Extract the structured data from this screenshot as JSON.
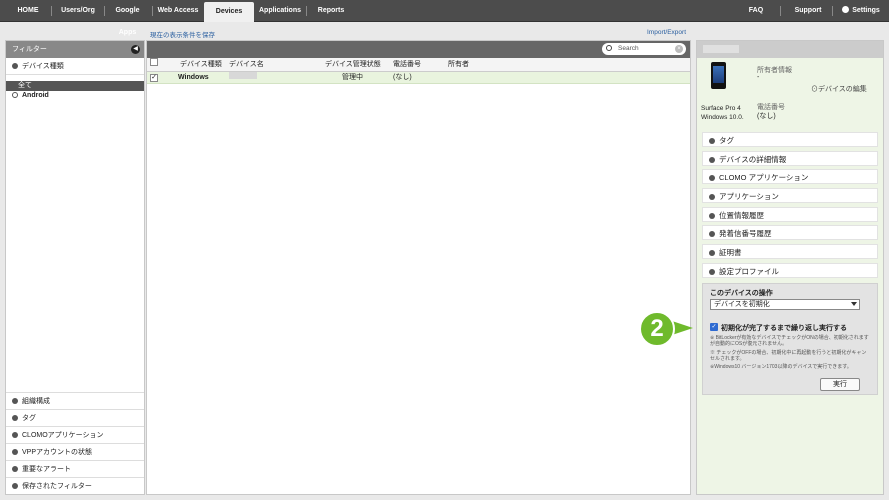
{
  "nav": {
    "tabs": [
      "HOME",
      "Users/Org",
      "Google Apps",
      "Web Access",
      "Devices",
      "Applications",
      "Reports"
    ],
    "active": "Devices",
    "right": [
      "FAQ",
      "Support",
      "Settings"
    ]
  },
  "subheader": {
    "save_filter": "現在の表示条件を保存",
    "import_export": "Import/Export"
  },
  "filter_panel": {
    "title": "フィルター",
    "device_type": "デバイス種類",
    "all": "全て",
    "android": "Android",
    "bottom_items": [
      "組織構成",
      "タグ",
      "CLOMOアプリケーション",
      "VPPアカウントの状態",
      "重要なアラート",
      "保存されたフィルター"
    ]
  },
  "device_list": {
    "search_placeholder": "Search",
    "columns": [
      "デバイス種類",
      "デバイス名",
      "デバイス管理状態",
      "電話番号",
      "所有者"
    ],
    "rows": [
      {
        "checked": "✓",
        "type": "Windows",
        "name": "",
        "status": "管理中",
        "phone": "(なし)",
        "owner": ""
      }
    ]
  },
  "device_detail": {
    "model": "Surface Pro 4",
    "os": "Windows 10.0.",
    "owner_label": "所有者情報",
    "owner_value": "-",
    "edit_link": "デバイスの編集",
    "phone_label": "電話番号",
    "phone_value": "(なし)",
    "sections": [
      "タグ",
      "デバイスの詳細情報",
      "CLOMO アプリケーション",
      "アプリケーション",
      "位置情報履歴",
      "発着信番号履歴",
      "証明書",
      "設定プロファイル"
    ]
  },
  "operations": {
    "title": "このデバイスの操作",
    "selected": "デバイスを初期化",
    "checkbox_label": "初期化が完了するまで繰り返し実行する",
    "notes": [
      "※ BitLockerが有効なデバイスでチェックがONの場合、初期化されますが自動的にOSが復元されません。",
      "※ チェックがOFFの場合、初期化中に再起動を行うと初期化がキャンセルされます。",
      "※Windows10 バージョン1703以降のデバイスで実行できます。"
    ],
    "execute": "実行"
  },
  "callout": {
    "number": "2",
    "color": "#6fba2c"
  }
}
